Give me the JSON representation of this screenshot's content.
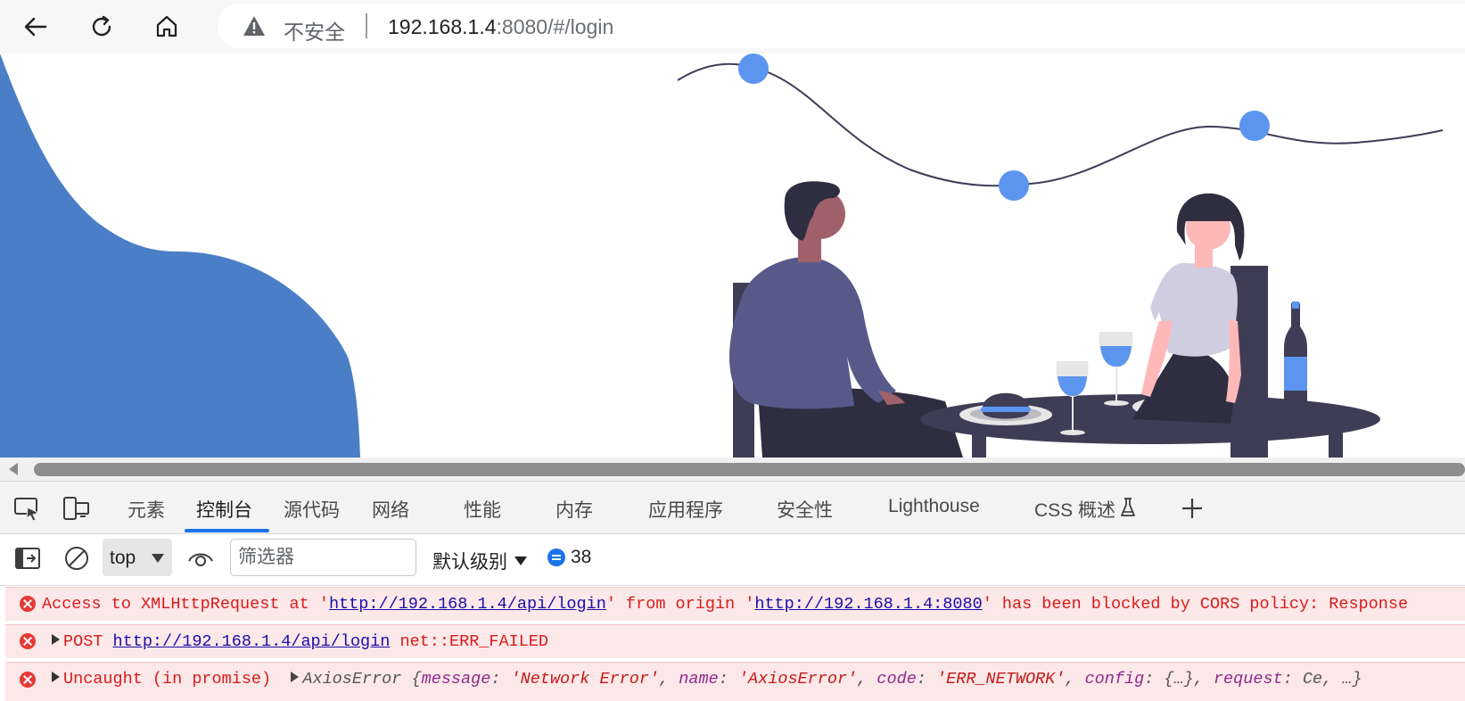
{
  "address_bar": {
    "security_label": "不安全",
    "url_host": "192.168.1.4",
    "url_rest": ":8080/#/login"
  },
  "devtools": {
    "tabs": [
      {
        "label": "元素"
      },
      {
        "label": "控制台"
      },
      {
        "label": "源代码"
      },
      {
        "label": "网络"
      },
      {
        "label": "性能"
      },
      {
        "label": "内存"
      },
      {
        "label": "应用程序"
      },
      {
        "label": "安全性"
      },
      {
        "label": "Lighthouse"
      },
      {
        "label": "CSS 概述"
      }
    ],
    "active_tab": "控制台",
    "toolbar": {
      "context": "top",
      "filter_placeholder": "筛选器",
      "level": "默认级别",
      "message_count": "38"
    },
    "messages": [
      {
        "level": "error",
        "prefix": "Access to XMLHttpRequest at '",
        "url1": "http://192.168.1.4/api/login",
        "middle": "' from origin '",
        "url2": "http://192.168.1.4:8080",
        "suffix": "' has been blocked by CORS policy: Response"
      },
      {
        "level": "error",
        "prefix": "POST ",
        "url": "http://192.168.1.4/api/login",
        "suffix": " net::ERR_FAILED"
      },
      {
        "level": "error",
        "prefix": "Uncaught (in promise)",
        "object_type": "AxiosError",
        "object_open": " {",
        "k1": "message",
        "v1": "'Network Error'",
        "k2": "name",
        "v2": "'AxiosError'",
        "k3": "code",
        "v3": "'ERR_NETWORK'",
        "k4": "config",
        "v4": "{…}",
        "k5": "request",
        "v5": "Ce, …}"
      }
    ]
  },
  "colors": {
    "page_blob": "#4a7ec7",
    "accent_dot": "#5b95f0",
    "error_text": "#d81b1b",
    "error_bg": "#fce8e8",
    "link": "#1a0dab",
    "active_tab_underline": "#1a73e8"
  }
}
